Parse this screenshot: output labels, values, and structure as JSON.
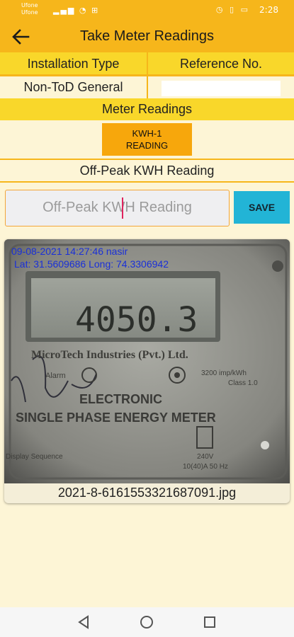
{
  "status_bar": {
    "carrier_top": "Ufone",
    "carrier_bottom": "Ufone",
    "time": "2:28"
  },
  "app_bar": {
    "title": "Take Meter Readings"
  },
  "info_table": {
    "col1_header": "Installation Type",
    "col2_header": "Reference No.",
    "installation_type_value": "Non-ToD General",
    "reference_no_value": ""
  },
  "meter_readings": {
    "section_title": "Meter Readings",
    "kwh_button_line1": "KWH-1",
    "kwh_button_line2": "READING",
    "reading_label": "Off-Peak KWH Reading"
  },
  "reading_input": {
    "placeholder": "Off-Peak KWH Reading",
    "value": ""
  },
  "save_button": {
    "label": "SAVE"
  },
  "photo": {
    "stamp_line1": "09-08-2021 14:27:46  nasir",
    "stamp_line2": "Lat: 31.5609686 Long: 74.3306942",
    "display_reading": "4050.3",
    "manufacturer": "MicroTech Industries (Pvt.) Ltd.",
    "alarm_label": "Alarm",
    "imp_label": "3200 imp/kWh",
    "class_label": "Class 1.0",
    "type_line1": "ELECTRONIC",
    "type_line2": "SINGLE PHASE ENERGY METER",
    "voltage": "240V",
    "current_rating": "10(40)A 50 Hz",
    "display_sequence": "Display Sequence",
    "filename": "2021-8-6161553321687091.jpg"
  },
  "nav_bar": {
    "back_icon": "triangle-back-icon",
    "home_icon": "circle-home-icon",
    "recents_icon": "square-recents-icon"
  },
  "colors": {
    "app_bar": "#f6b61b",
    "table_header": "#f9d72a",
    "kwh_button": "#f7a70c",
    "save_button": "#22b4d6",
    "background": "#fdf5d6"
  }
}
